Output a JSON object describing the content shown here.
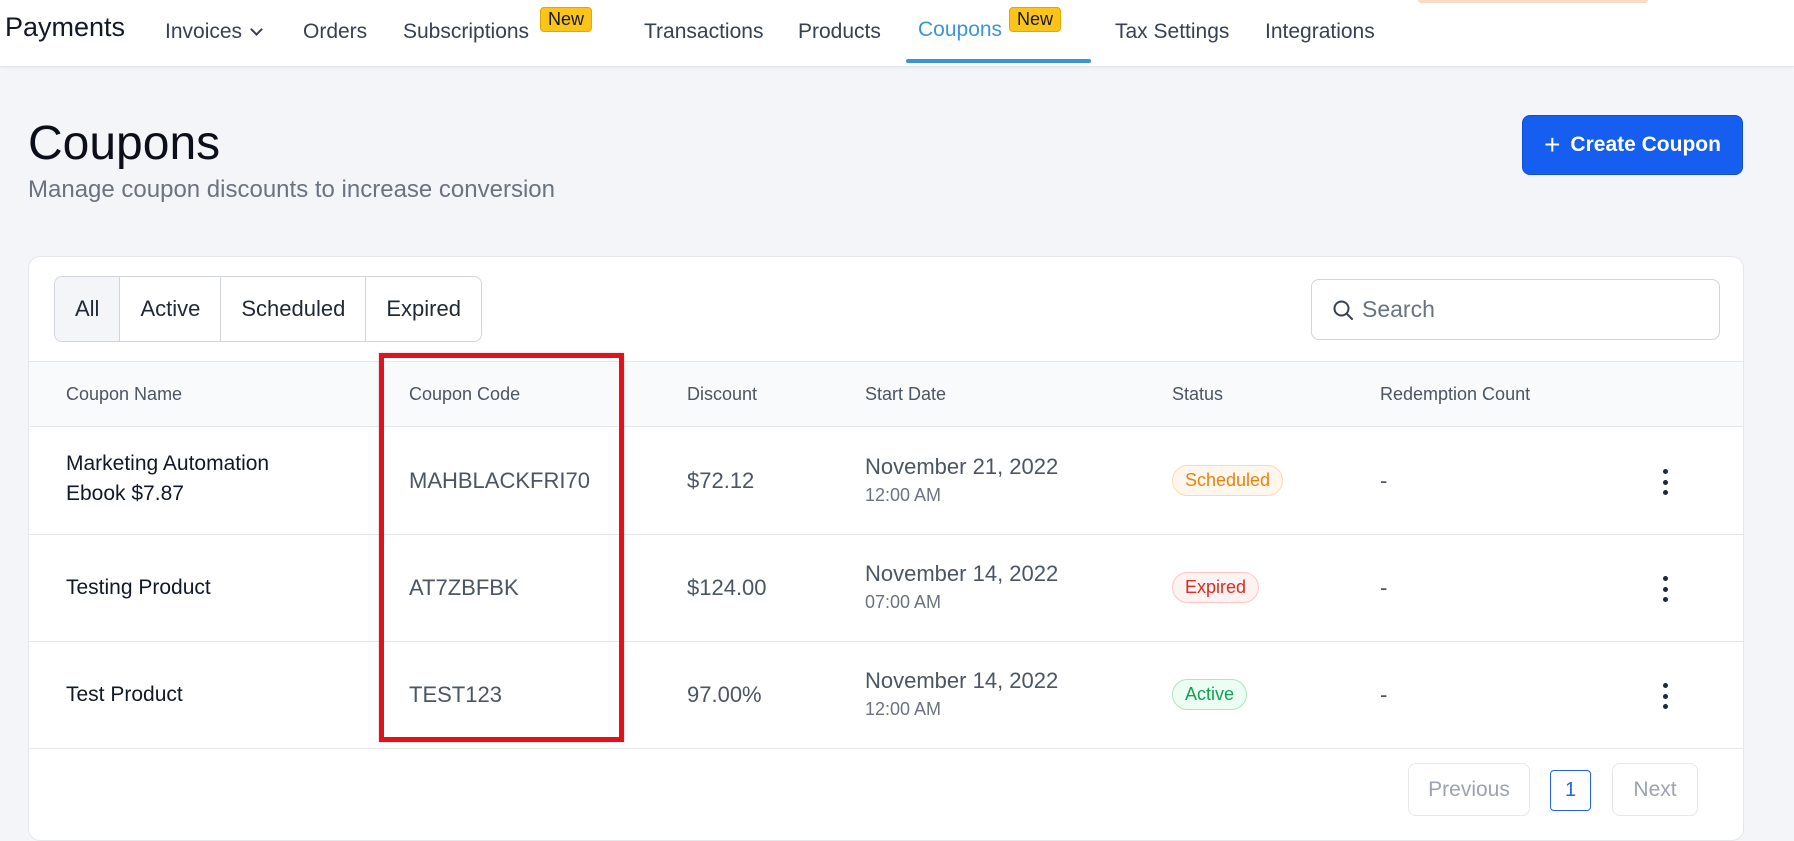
{
  "nav": {
    "brand": "Payments",
    "items": [
      {
        "label": "Invoices"
      },
      {
        "label": "Orders"
      },
      {
        "label": "Subscriptions",
        "badge": "New"
      },
      {
        "label": "Transactions"
      },
      {
        "label": "Products"
      },
      {
        "label": "Coupons",
        "badge": "New",
        "active": true
      },
      {
        "label": "Tax Settings"
      },
      {
        "label": "Integrations"
      }
    ]
  },
  "page": {
    "title": "Coupons",
    "subtitle": "Manage coupon discounts to increase conversion",
    "create_button": "Create Coupon"
  },
  "filters": [
    "All",
    "Active",
    "Scheduled",
    "Expired"
  ],
  "search": {
    "placeholder": "Search"
  },
  "table": {
    "columns": [
      "Coupon Name",
      "Coupon Code",
      "Discount",
      "Start Date",
      "Status",
      "Redemption Count"
    ],
    "rows": [
      {
        "name_line1": "Marketing Automation",
        "name_line2": "Ebook $7.87",
        "code": "MAHBLACKFRI70",
        "discount": "$72.12",
        "date": "November 21, 2022",
        "time": "12:00 AM",
        "status": "Scheduled",
        "redemptions": "-"
      },
      {
        "name_line1": "Testing Product",
        "name_line2": "",
        "code": "AT7ZBFBK",
        "discount": "$124.00",
        "date": "November 14, 2022",
        "time": "07:00 AM",
        "status": "Expired",
        "redemptions": "-"
      },
      {
        "name_line1": "Test Product",
        "name_line2": "",
        "code": "TEST123",
        "discount": "97.00%",
        "date": "November 14, 2022",
        "time": "12:00 AM",
        "status": "Active",
        "redemptions": "-"
      }
    ]
  },
  "pagination": {
    "previous": "Previous",
    "current": "1",
    "next": "Next"
  },
  "colors": {
    "accent": "#155eef",
    "nav_active": "#3b95d4",
    "highlight": "#e0121b",
    "badge": "#fcc419"
  }
}
